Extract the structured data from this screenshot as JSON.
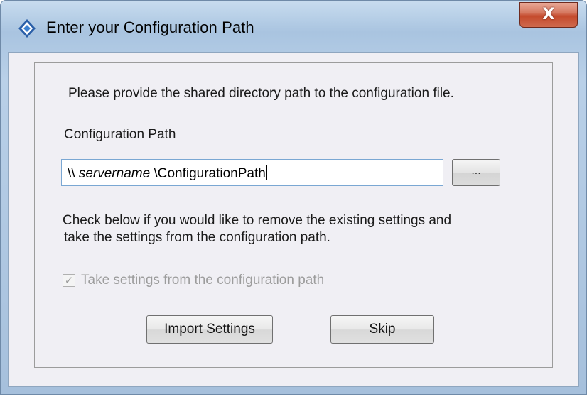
{
  "window": {
    "title": "Enter your Configuration Path",
    "close_glyph": "X"
  },
  "content": {
    "instruction": "Please provide the shared directory path to the configuration file.",
    "path_label": "Configuration Path",
    "path_value_prefix": "\\\\",
    "path_value_server": "servername",
    "path_value_suffix": "\\ConfigurationPath",
    "browse_label": "...",
    "note_line1": "Check below if you would like to remove the existing settings and",
    "note_line2": "take the settings from the configuration path.",
    "checkbox_label": "Take settings from the configuration path",
    "checkbox_checked": true,
    "checkbox_enabled": false,
    "import_label": "Import Settings",
    "skip_label": "Skip"
  },
  "icons": {
    "app": "app-logo-icon",
    "close": "close-icon",
    "check": "check-icon"
  },
  "colors": {
    "close_button": "#c44a2c",
    "textbox_border": "#7aa7d3",
    "disabled_text": "#9c9c9c"
  }
}
